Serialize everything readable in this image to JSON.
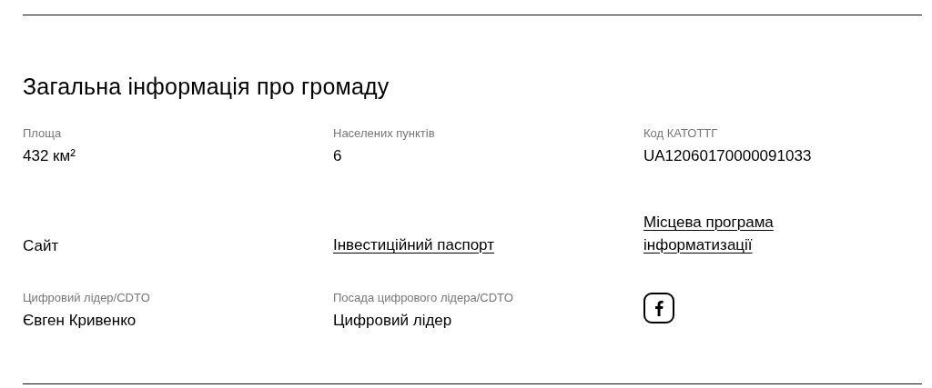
{
  "title": "Загальна інформація про громаду",
  "rows": [
    [
      {
        "kind": "field",
        "label": "Площа",
        "value": "432 км²"
      },
      {
        "kind": "field",
        "label": "Населених пунктів",
        "value": "6"
      },
      {
        "kind": "field",
        "label": "Код КАТОТТГ",
        "value": "UA12060170000091033"
      }
    ],
    [
      {
        "kind": "text",
        "value": "Сайт"
      },
      {
        "kind": "link",
        "value": "Інвестиційний паспорт"
      },
      {
        "kind": "link",
        "value": "Місцева програма інформатизації"
      }
    ],
    [
      {
        "kind": "field",
        "label": "Цифровий лідер/CDTO",
        "value": "Євген Кривенко"
      },
      {
        "kind": "field",
        "label": "Посада цифрового лідера/CDTO",
        "value": "Цифровий лідер"
      },
      {
        "kind": "social"
      }
    ]
  ]
}
